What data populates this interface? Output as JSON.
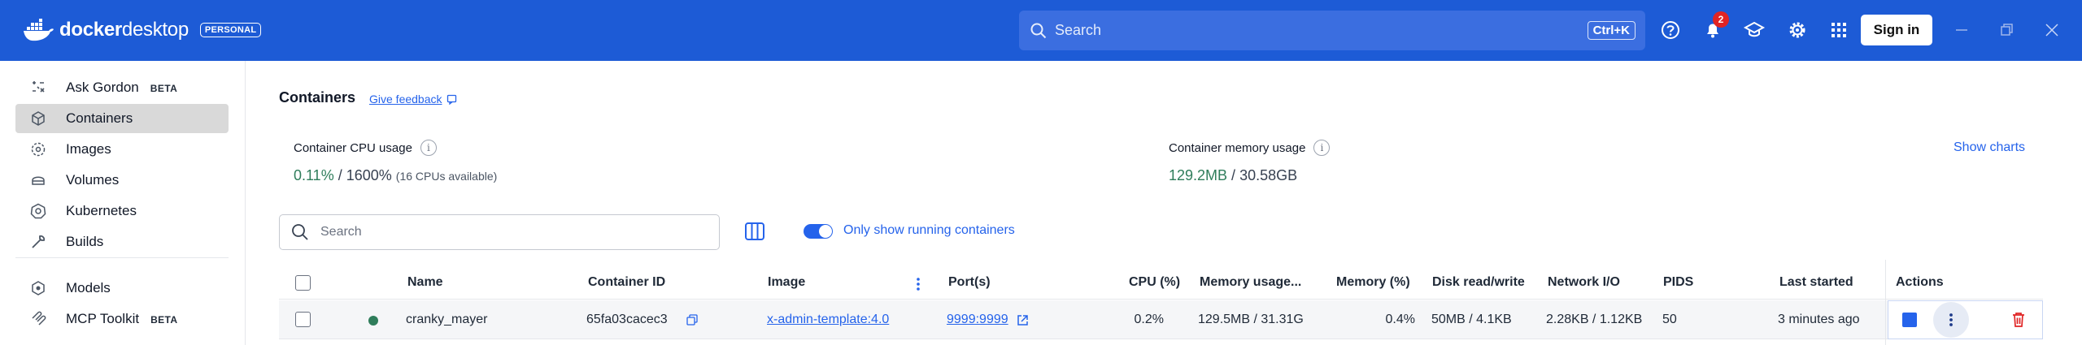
{
  "app": {
    "brand_bold": "docker",
    "brand_light": "desktop",
    "plan_badge": "PERSONAL"
  },
  "topbar": {
    "search_placeholder": "Search",
    "shortcut": "Ctrl+K",
    "notifications_count": "2",
    "sign_in_label": "Sign in",
    "icons": [
      "help-icon",
      "bell-icon",
      "learning-center-icon",
      "settings-icon",
      "apps-grid-icon",
      "minimize-icon",
      "maximize-icon",
      "close-icon"
    ]
  },
  "sidebar": {
    "items": [
      {
        "label": "Ask Gordon",
        "badge": "BETA",
        "icon": "gordon-icon"
      },
      {
        "label": "Containers",
        "icon": "container-icon",
        "active": true
      },
      {
        "label": "Images",
        "icon": "image-icon"
      },
      {
        "label": "Volumes",
        "icon": "volume-icon"
      },
      {
        "label": "Kubernetes",
        "icon": "kubernetes-icon"
      },
      {
        "label": "Builds",
        "icon": "wrench-icon"
      },
      {
        "label": "Models",
        "icon": "models-icon"
      },
      {
        "label": "MCP Toolkit",
        "badge": "BETA",
        "icon": "mcp-icon"
      }
    ]
  },
  "main": {
    "title": "Containers",
    "feedback_label": "Give feedback",
    "cpu": {
      "label": "Container CPU usage",
      "used": "0.11%",
      "total": "1600%",
      "note": "(16 CPUs available)"
    },
    "memory": {
      "label": "Container memory usage",
      "used": "129.2MB",
      "total": "30.58GB"
    },
    "show_charts_label": "Show charts",
    "filter_placeholder": "Search",
    "toggle_label": "Only show running containers",
    "toggle_on": true
  },
  "table": {
    "columns": {
      "name": "Name",
      "container_id": "Container ID",
      "image": "Image",
      "ports": "Port(s)",
      "cpu": "CPU (%)",
      "memory_usage": "Memory usage...",
      "memory_pct": "Memory (%)",
      "disk": "Disk read/write",
      "network": "Network I/O",
      "pids": "PIDS",
      "last_started": "Last started",
      "actions": "Actions"
    },
    "rows": [
      {
        "name": "cranky_mayer",
        "status": "running",
        "container_id": "65fa03cacec3",
        "image": "x-admin-template:4.0",
        "ports": "9999:9999",
        "cpu": "0.2%",
        "memory_usage": "129.5MB / 31.31G",
        "memory_pct": "0.4%",
        "disk": "50MB / 4.1KB",
        "network": "2.28KB / 1.12KB",
        "pids": "50",
        "last_started": "3 minutes ago"
      }
    ]
  },
  "colors": {
    "titlebar": "#1d5bd6",
    "accent": "#2563eb",
    "running": "#2f7d5b",
    "danger": "#e02424"
  }
}
